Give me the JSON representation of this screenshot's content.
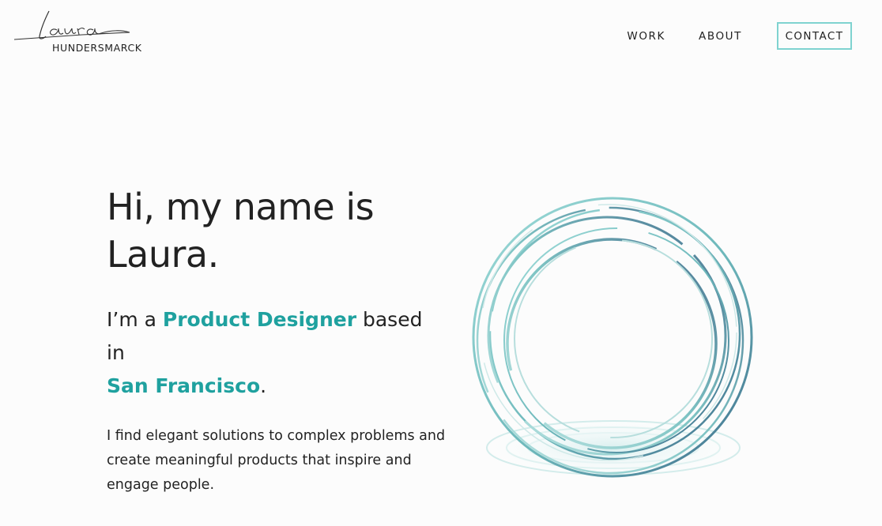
{
  "header": {
    "logo_script": "Laura",
    "logo_sub": "HUNDERSMARCK",
    "nav": {
      "work": "WORK",
      "about": "ABOUT",
      "contact": "CONTACT"
    }
  },
  "hero": {
    "headline_line1": "Hi, my name is",
    "headline_line2": "Laura.",
    "sub_prefix": "I’m a ",
    "sub_role": "Product Designer",
    "sub_middle": " based in",
    "sub_city": "San Francisco",
    "sub_suffix": ".",
    "description": "I find elegant solutions to complex problems and create meaningful products that inspire and engage people."
  },
  "colors": {
    "accent": "#1fa19f",
    "contact_border": "#7fd3d0",
    "ring_teal": "#7cc8c6",
    "ring_blue": "#4f7a96"
  },
  "icons": {
    "hero_art": "concentric-rings-illustration"
  }
}
